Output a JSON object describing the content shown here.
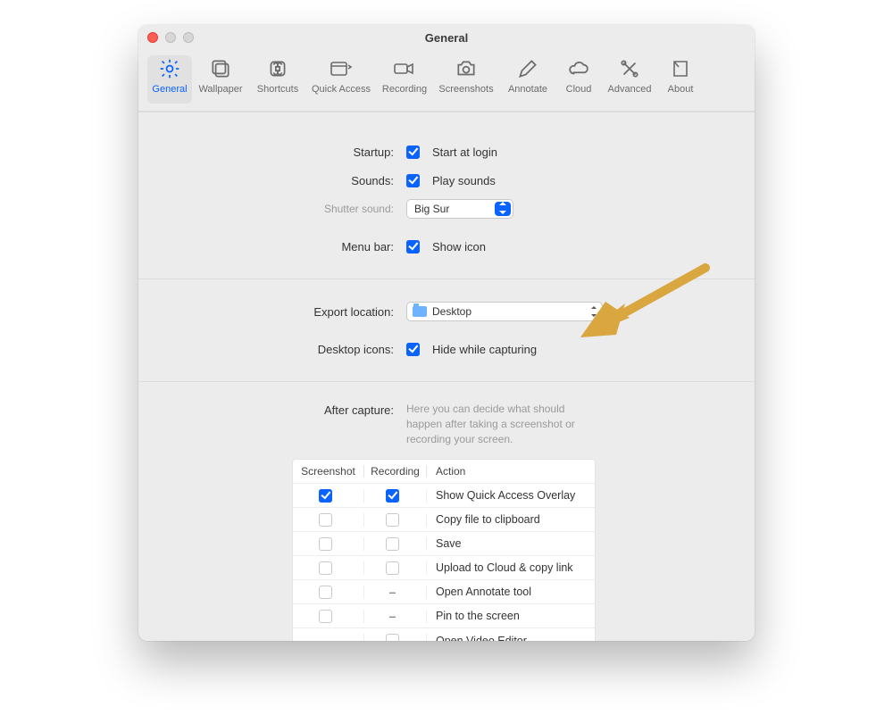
{
  "window": {
    "title": "General"
  },
  "toolbar": {
    "items": [
      {
        "id": "general",
        "label": "General"
      },
      {
        "id": "wallpaper",
        "label": "Wallpaper"
      },
      {
        "id": "shortcuts",
        "label": "Shortcuts"
      },
      {
        "id": "quickaccess",
        "label": "Quick Access"
      },
      {
        "id": "recording",
        "label": "Recording"
      },
      {
        "id": "screenshots",
        "label": "Screenshots"
      },
      {
        "id": "annotate",
        "label": "Annotate"
      },
      {
        "id": "cloud",
        "label": "Cloud"
      },
      {
        "id": "advanced",
        "label": "Advanced"
      },
      {
        "id": "about",
        "label": "About"
      }
    ]
  },
  "section1": {
    "startup": {
      "label": "Startup:",
      "cb_label": "Start at login",
      "checked": true
    },
    "sounds": {
      "label": "Sounds:",
      "cb_label": "Play sounds",
      "checked": true
    },
    "shutter": {
      "label": "Shutter sound:",
      "value": "Big Sur"
    },
    "menubar": {
      "label": "Menu bar:",
      "cb_label": "Show icon",
      "checked": true
    }
  },
  "section2": {
    "export": {
      "label": "Export location:",
      "value": "Desktop"
    },
    "desktop": {
      "label": "Desktop icons:",
      "cb_label": "Hide while capturing",
      "checked": true
    }
  },
  "section3": {
    "after": {
      "label": "After capture:",
      "help": "Here you can decide what should happen after taking a screenshot or recording your screen."
    },
    "columns": {
      "c1": "Screenshot",
      "c2": "Recording",
      "c3": "Action"
    },
    "rows": [
      {
        "s": "on",
        "r": "on",
        "action": "Show Quick Access Overlay"
      },
      {
        "s": "off",
        "r": "off",
        "action": "Copy file to clipboard"
      },
      {
        "s": "off",
        "r": "off",
        "action": "Save"
      },
      {
        "s": "off",
        "r": "off",
        "action": "Upload to Cloud & copy link"
      },
      {
        "s": "off",
        "r": "na",
        "action": "Open Annotate tool"
      },
      {
        "s": "off",
        "r": "na",
        "action": "Pin to the screen"
      },
      {
        "s": "na",
        "r": "off",
        "action": "Open Video Editor"
      }
    ]
  }
}
